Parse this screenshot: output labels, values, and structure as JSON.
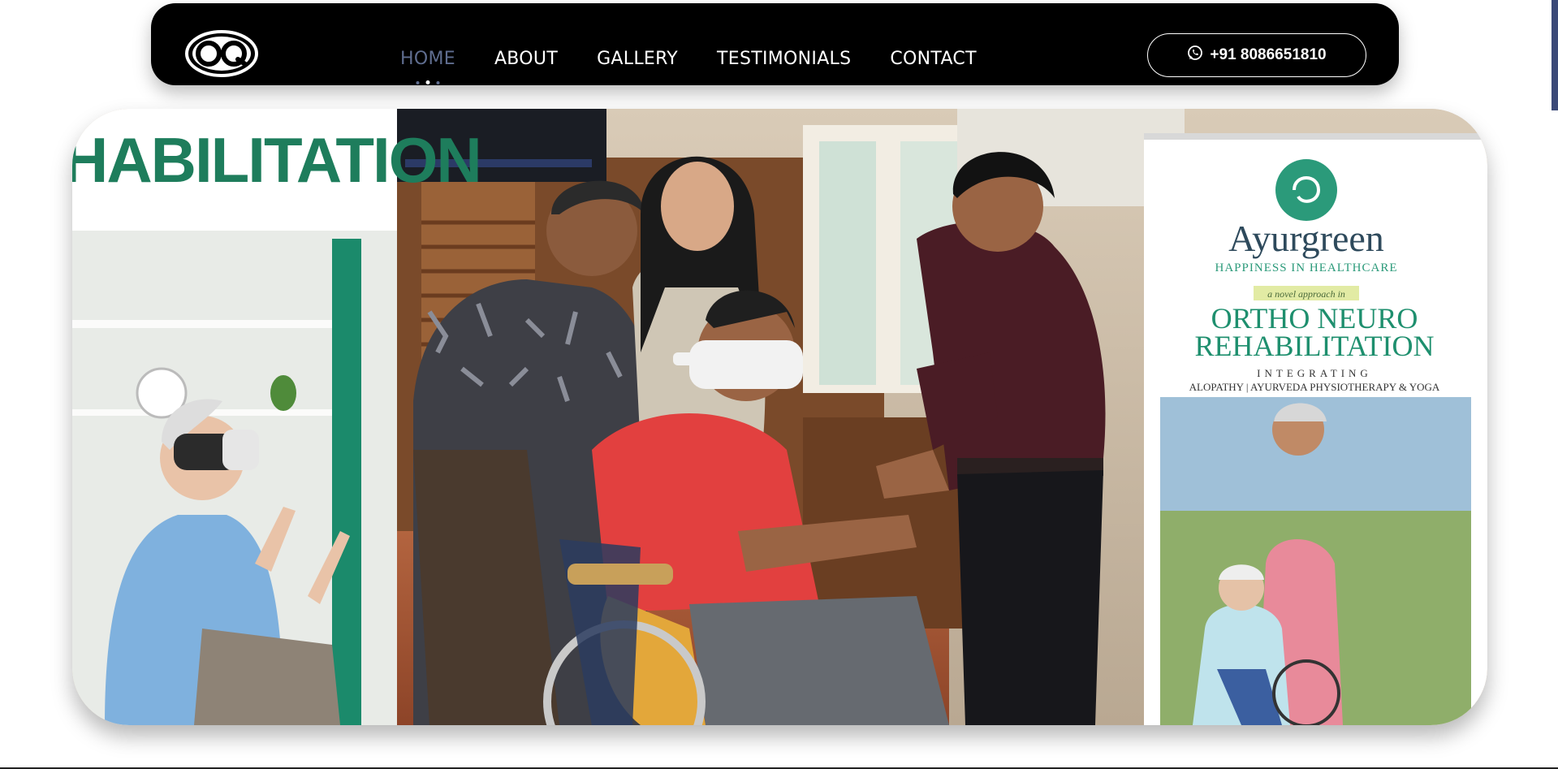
{
  "logo": {
    "text": "OQ",
    "icon": "oq-logo-icon"
  },
  "nav": {
    "items": [
      {
        "label": "HOME",
        "active": true
      },
      {
        "label": "ABOUT",
        "active": false
      },
      {
        "label": "GALLERY",
        "active": false
      },
      {
        "label": "TESTIMONIALS",
        "active": false
      },
      {
        "label": "CONTACT",
        "active": false
      }
    ],
    "phone_label": "+91 8086651810",
    "phone_icon": "whatsapp-icon"
  },
  "hero": {
    "left_banner": {
      "heading": "HABILITATION"
    },
    "right_banner": {
      "brand": "Ayurgreen",
      "tagline": "HAPPINESS IN HEALTHCARE",
      "approach": "a novel approach in",
      "title_line1": "ORTHO NEURO",
      "title_line2": "REHABILITATION",
      "integrating": "INTEGRATING",
      "disciplines": "ALOPATHY | AYURVEDA  PHYSIOTHERAPY  &  YOGA"
    }
  },
  "colors": {
    "nav_bg": "#000000",
    "nav_active": "#5f6d8f",
    "nav_text": "#ffffff",
    "banner_green": "#1e8a6a",
    "accent": "#3c4a78"
  }
}
